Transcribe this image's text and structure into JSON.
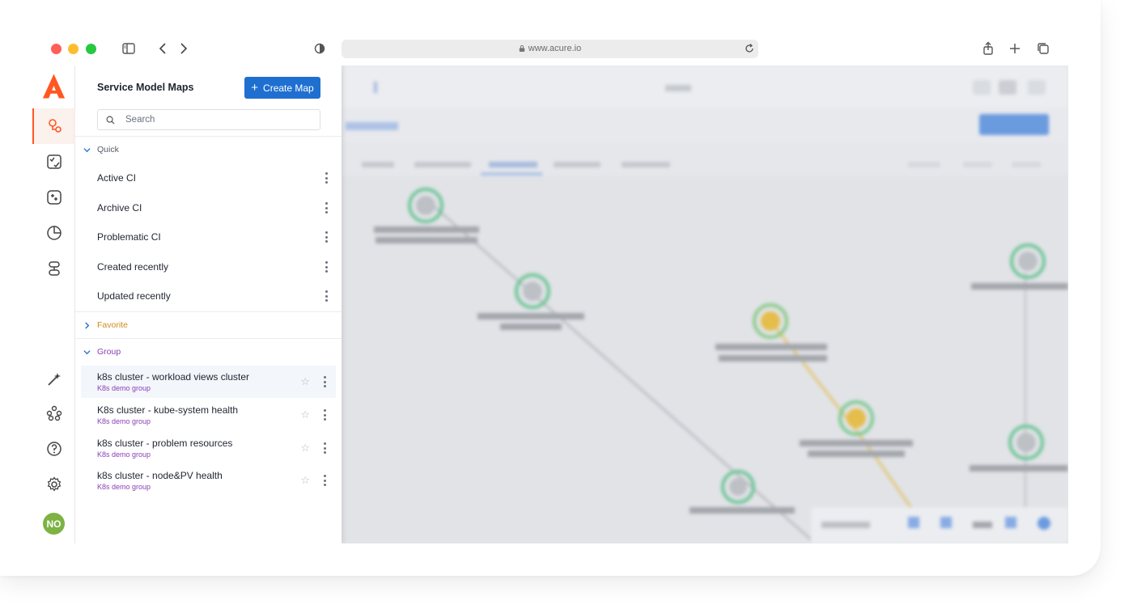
{
  "browser": {
    "url": "www.acure.io"
  },
  "panel": {
    "title": "Service Model Maps",
    "create_button": "Create Map",
    "search_placeholder": "Search",
    "sections": {
      "quick": "Quick",
      "favorite": "Favorite",
      "group": "Group"
    },
    "quick_items": [
      {
        "label": "Active CI"
      },
      {
        "label": "Archive CI"
      },
      {
        "label": "Problematic CI"
      },
      {
        "label": "Created recently"
      },
      {
        "label": "Updated recently"
      }
    ],
    "group_items": [
      {
        "label": "k8s cluster - workload views cluster",
        "group": "K8s demo group"
      },
      {
        "label": "K8s cluster - kube-system health",
        "group": "K8s demo group"
      },
      {
        "label": "k8s cluster - problem resources",
        "group": "K8s demo group"
      },
      {
        "label": "k8s cluster - node&PV health",
        "group": "K8s demo group"
      }
    ]
  },
  "user": {
    "initials": "NO"
  },
  "colors": {
    "brand": "#ff5722",
    "primary": "#1f6fd1",
    "favorite": "#d08b1a",
    "group": "#8a3fb5"
  },
  "icons": {
    "rail": [
      "service-map-icon",
      "checklist-icon",
      "automation-icon",
      "reports-icon",
      "signals-icon",
      "magic-wand-icon",
      "nodes-icon",
      "help-icon",
      "settings-icon"
    ]
  }
}
